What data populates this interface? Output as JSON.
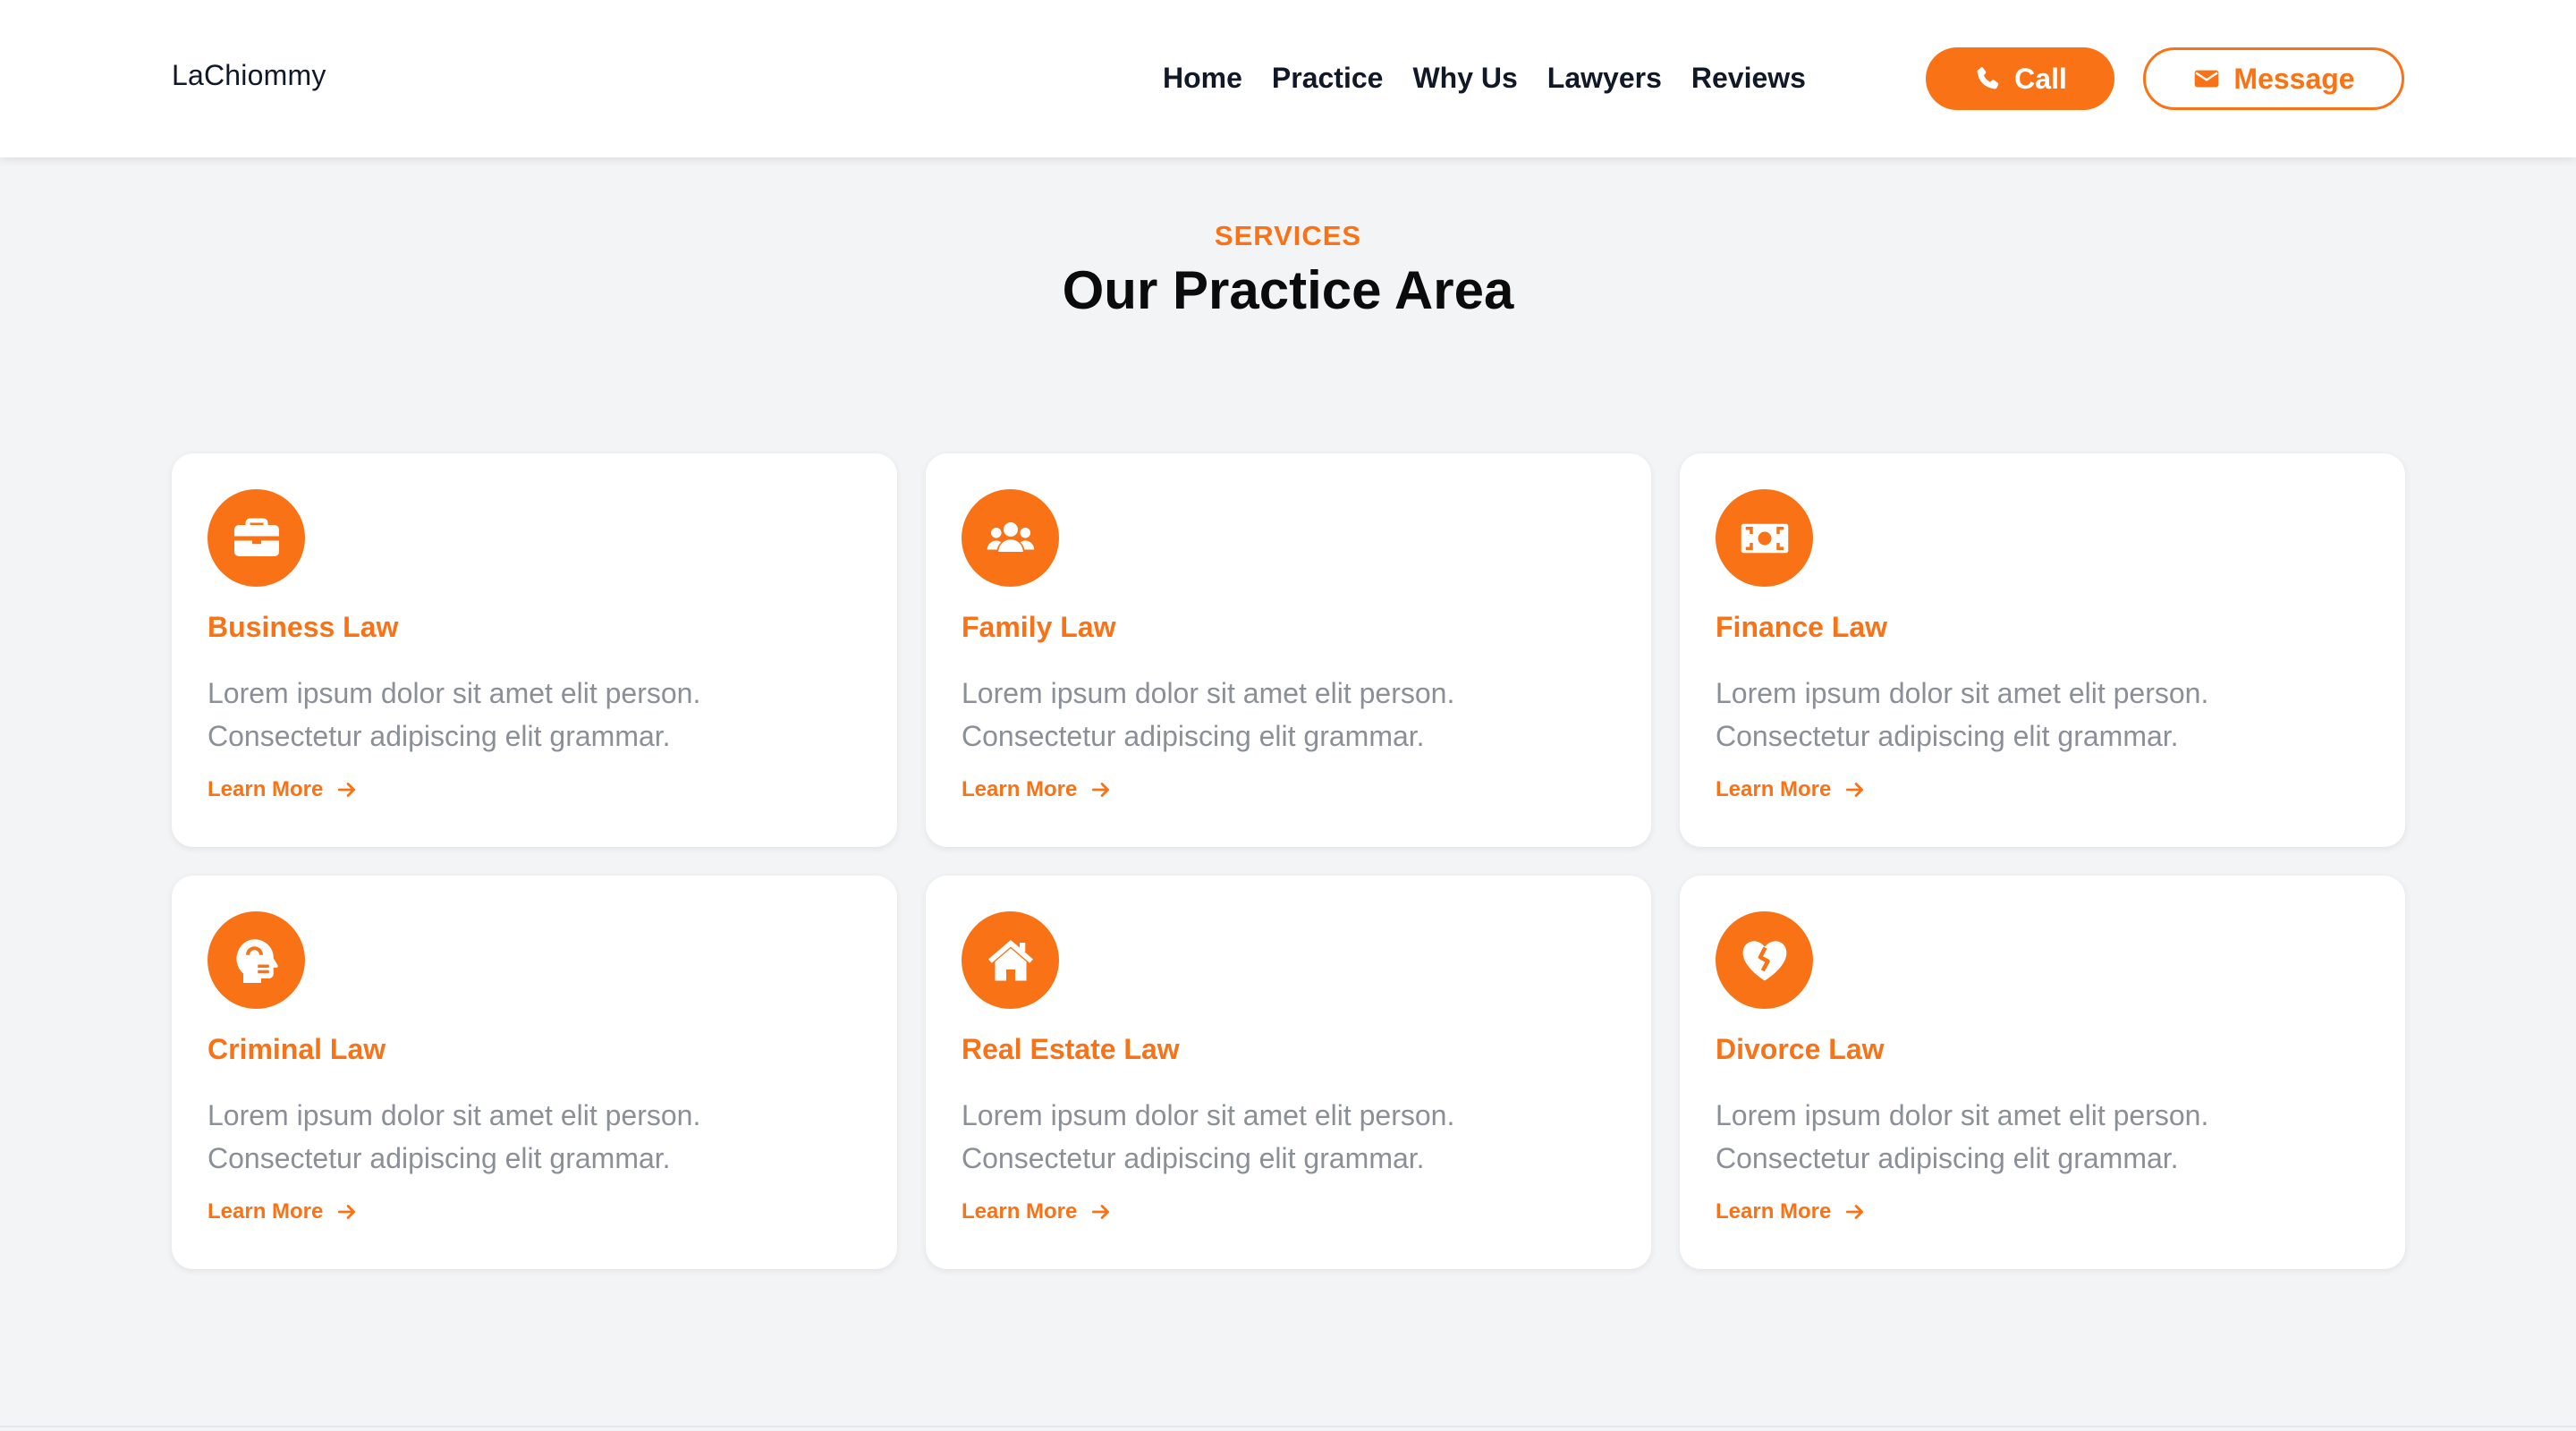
{
  "brand": "LaChiommy",
  "nav": {
    "links": [
      "Home",
      "Practice",
      "Why Us",
      "Lawyers",
      "Reviews"
    ],
    "call_label": "Call",
    "message_label": "Message"
  },
  "section": {
    "eyebrow": "SERVICES",
    "title": "Our Practice Area"
  },
  "cards": [
    {
      "title": "Business Law",
      "icon": "briefcase-icon",
      "desc_1": "Lorem ipsum dolor sit amet elit person.",
      "desc_2": "Consectetur adipiscing elit grammar.",
      "link": "Learn More"
    },
    {
      "title": "Family Law",
      "icon": "people-icon",
      "desc_1": "Lorem ipsum dolor sit amet elit person.",
      "desc_2": "Consectetur adipiscing elit grammar.",
      "link": "Learn More"
    },
    {
      "title": "Finance Law",
      "icon": "money-bill-icon",
      "desc_1": "Lorem ipsum dolor sit amet elit person.",
      "desc_2": "Consectetur adipiscing elit grammar.",
      "link": "Learn More"
    },
    {
      "title": "Criminal Law",
      "icon": "head-side-icon",
      "desc_1": "Lorem ipsum dolor sit amet elit person.",
      "desc_2": "Consectetur adipiscing elit grammar.",
      "link": "Learn More"
    },
    {
      "title": "Real Estate Law",
      "icon": "house-icon",
      "desc_1": "Lorem ipsum dolor sit amet elit person.",
      "desc_2": "Consectetur adipiscing elit grammar.",
      "link": "Learn More"
    },
    {
      "title": "Divorce Law",
      "icon": "heart-broken-icon",
      "desc_1": "Lorem ipsum dolor sit amet elit person.",
      "desc_2": "Consectetur adipiscing elit grammar.",
      "link": "Learn More"
    }
  ],
  "colors": {
    "accent": "#f97316",
    "page_bg": "#f3f4f6",
    "card_bg": "#ffffff",
    "text_dark": "#111827",
    "text_muted": "#8b8f98"
  }
}
